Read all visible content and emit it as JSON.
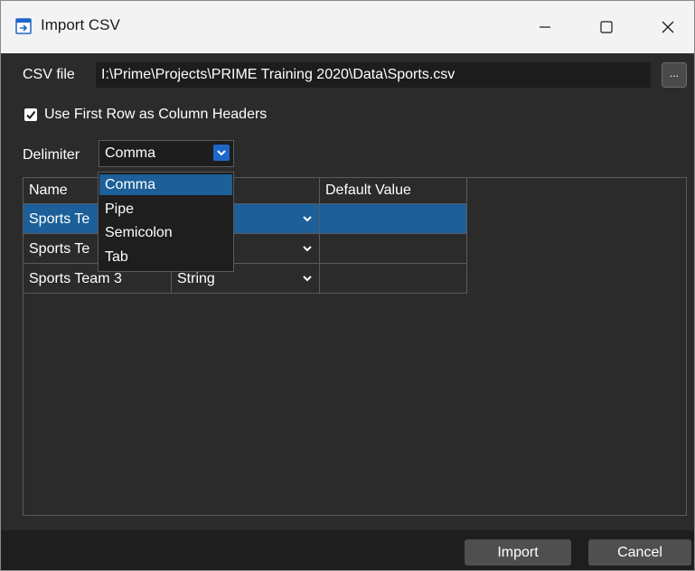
{
  "window": {
    "title": "Import CSV"
  },
  "csv": {
    "label": "CSV file",
    "path": "I:\\Prime\\Projects\\PRIME Training 2020\\Data\\Sports.csv",
    "browse_label": "..."
  },
  "header_checkbox": {
    "label": "Use First Row as Column Headers",
    "checked": true
  },
  "delimiter": {
    "label": "Delimiter",
    "selected": "Comma",
    "options": [
      "Comma",
      "Pipe",
      "Semicolon",
      "Tab"
    ]
  },
  "grid": {
    "columns": [
      "Name",
      "",
      "Default Value"
    ],
    "rows": [
      {
        "name": "Sports Te",
        "type": "",
        "default": ""
      },
      {
        "name": "Sports Te",
        "type": "",
        "default": ""
      },
      {
        "name": "Sports Team 3",
        "type": "String",
        "default": ""
      }
    ]
  },
  "footer": {
    "import_label": "Import",
    "cancel_label": "Cancel"
  },
  "colors": {
    "accent": "#1e66c9",
    "selection": "#1c5f99",
    "background": "#2b2b2b"
  }
}
